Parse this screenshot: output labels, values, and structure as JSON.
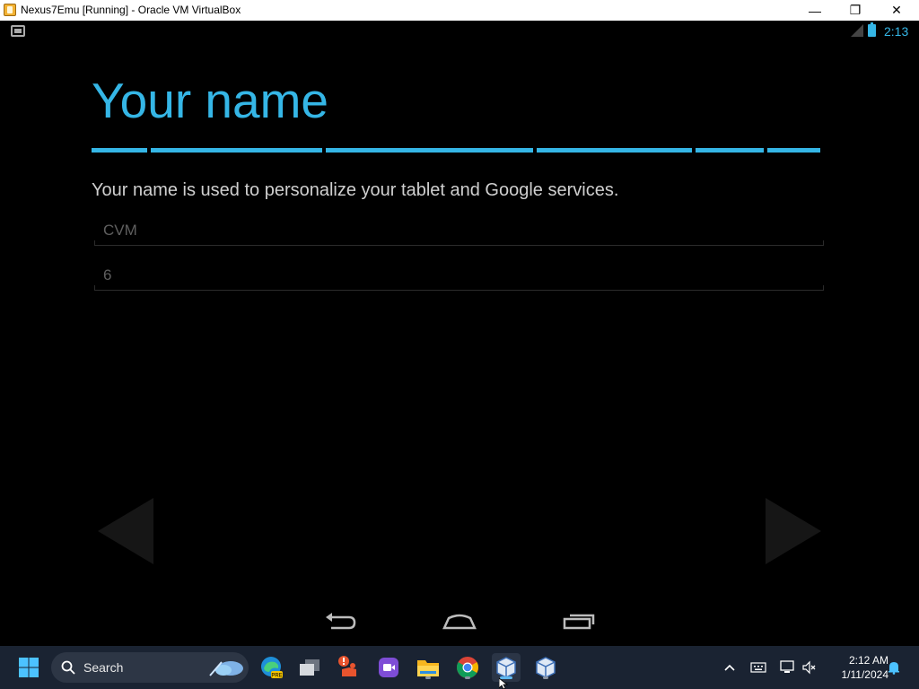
{
  "window": {
    "title": "Nexus7Emu [Running] - Oracle VM VirtualBox",
    "minimize_glyph": "—",
    "maximize_glyph": "❐",
    "close_glyph": "✕"
  },
  "android": {
    "status_time": "2:13",
    "heading": "Your name",
    "description": "Your name is used to personalize your tablet and Google services.",
    "first_name_value": "CVM",
    "last_name_value": "6",
    "progress_segments": 6,
    "accent_color": "#35b6e6"
  },
  "taskbar": {
    "search_label": "Search",
    "clock_time": "2:12 AM",
    "clock_date": "1/11/2024",
    "apps": [
      "windows-start-icon",
      "edge-beta-icon",
      "task-view-icon",
      "fsm-app-icon",
      "clipchamp-icon",
      "file-explorer-icon",
      "chrome-icon",
      "virtualbox-vm-icon",
      "virtualbox-manager-icon"
    ],
    "tray": [
      "chevron-up-icon",
      "keyboard-icon",
      "network-icon",
      "volume-muted-icon",
      "notification-bell-icon"
    ]
  }
}
